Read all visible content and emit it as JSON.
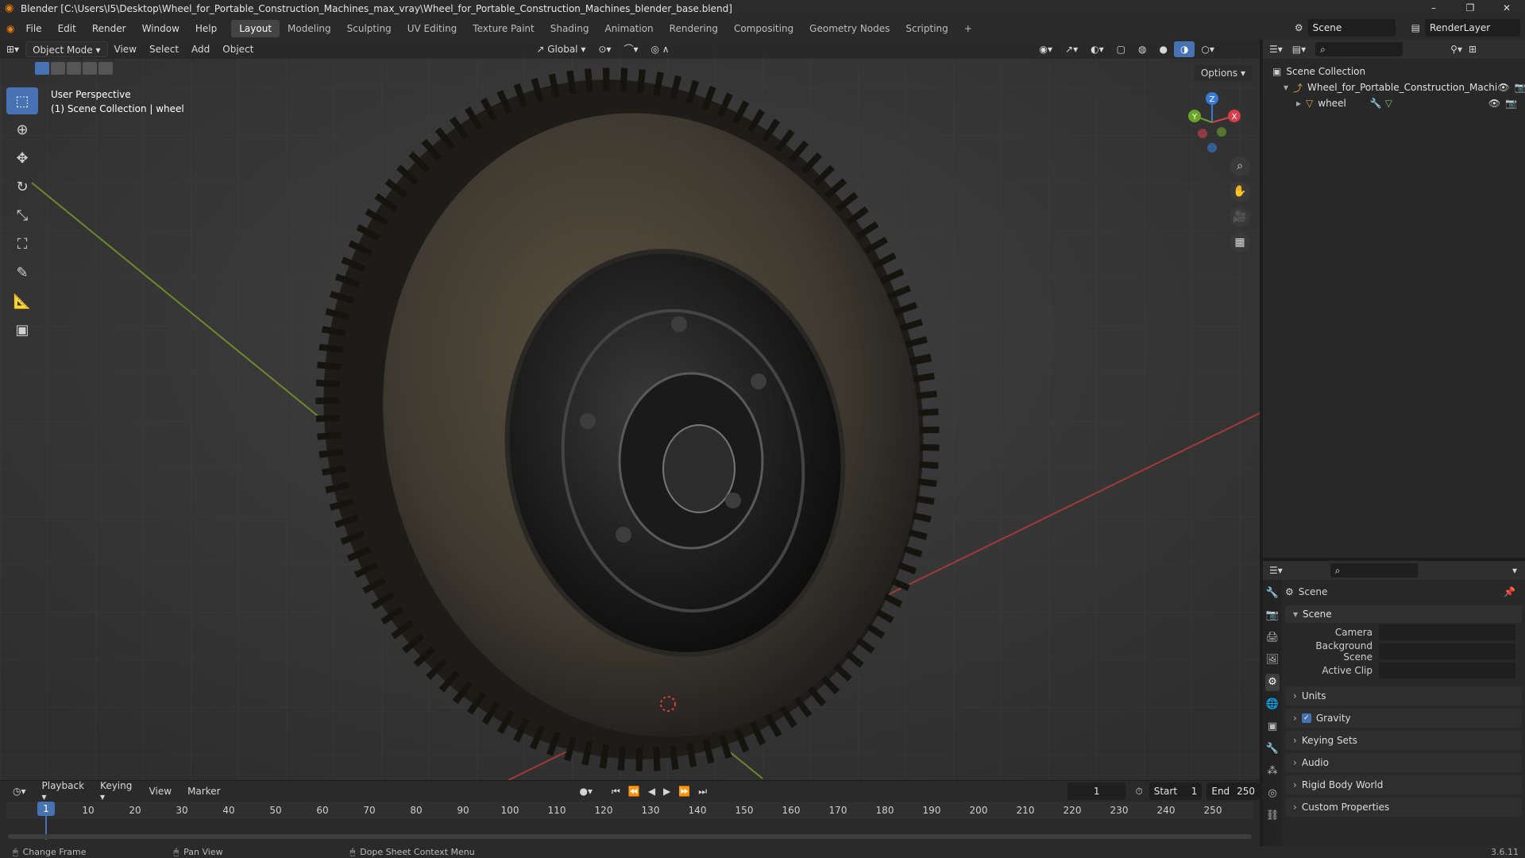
{
  "window": {
    "title": "Blender [C:\\Users\\I5\\Desktop\\Wheel_for_Portable_Construction_Machines_max_vray\\Wheel_for_Portable_Construction_Machines_blender_base.blend]",
    "minimize": "–",
    "maximize": "❐",
    "close": "✕"
  },
  "menu": [
    "File",
    "Edit",
    "Render",
    "Window",
    "Help"
  ],
  "workspaces": [
    "Layout",
    "Modeling",
    "Sculpting",
    "UV Editing",
    "Texture Paint",
    "Shading",
    "Animation",
    "Rendering",
    "Compositing",
    "Geometry Nodes",
    "Scripting",
    "+"
  ],
  "active_workspace": "Layout",
  "scene_field": "Scene",
  "renderlayer_field": "RenderLayer",
  "viewport": {
    "mode": "Object Mode",
    "menus": [
      "View",
      "Select",
      "Add",
      "Object"
    ],
    "transform_orientation": "Global",
    "options": "Options",
    "info_line1": "User Perspective",
    "info_line2": "(1) Scene Collection | wheel",
    "gizmo": {
      "x": "X",
      "y": "Y",
      "z": "Z"
    }
  },
  "outliner": {
    "root": "Scene Collection",
    "collection": "Wheel_for_Portable_Construction_Machi",
    "object": "wheel"
  },
  "properties": {
    "header": "Scene",
    "panel": "Scene",
    "camera_label": "Camera",
    "background_label": "Background Scene",
    "clip_label": "Active Clip",
    "subpanels": [
      "Units",
      "Gravity",
      "Keying Sets",
      "Audio",
      "Rigid Body World",
      "Custom Properties"
    ]
  },
  "timeline": {
    "menus": [
      "Playback",
      "Keying",
      "View",
      "Marker"
    ],
    "current_frame": "1",
    "start_label": "Start",
    "start": "1",
    "end_label": "End",
    "end": "250",
    "ticks": [
      "10",
      "20",
      "30",
      "40",
      "50",
      "60",
      "70",
      "80",
      "90",
      "100",
      "110",
      "120",
      "130",
      "140",
      "150",
      "160",
      "170",
      "180",
      "190",
      "200",
      "210",
      "220",
      "230",
      "240",
      "250"
    ],
    "playhead": "1"
  },
  "status": {
    "left": "Change Frame",
    "middle": "Pan View",
    "right": "Dope Sheet Context Menu",
    "version": "3.6.11"
  },
  "colors": {
    "accent": "#4772b3",
    "brand": "#e87d0d",
    "x_axis": "#d2404e",
    "y_axis": "#6aa32a",
    "z_axis": "#3a7bd5"
  }
}
